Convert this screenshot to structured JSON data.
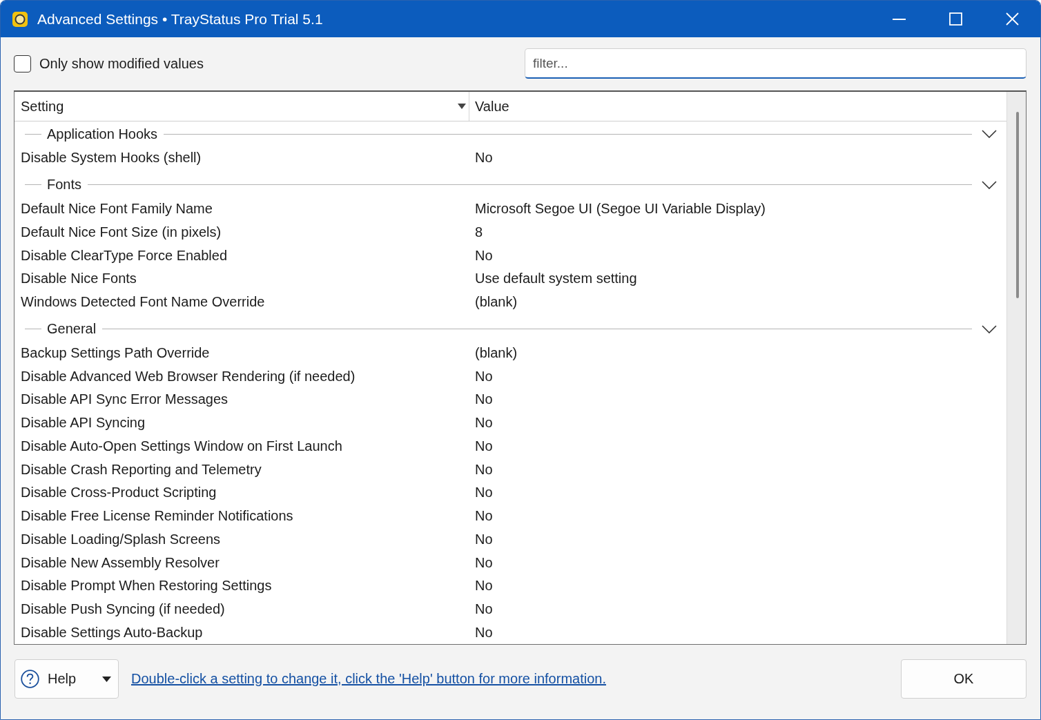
{
  "window": {
    "title": "Advanced Settings • TrayStatus Pro Trial 5.1"
  },
  "toolbar": {
    "only_modified": {
      "label": "Only show modified values",
      "checked": false
    },
    "filter": {
      "placeholder": "filter...",
      "focused": true
    }
  },
  "table": {
    "columns": [
      "Setting",
      "Value"
    ],
    "groups": [
      {
        "name": "Application Hooks",
        "expanded": true,
        "rows": [
          {
            "setting": "Disable System Hooks (shell)",
            "value": "No"
          }
        ]
      },
      {
        "name": "Fonts",
        "expanded": true,
        "rows": [
          {
            "setting": "Default Nice Font Family Name",
            "value": "Microsoft Segoe UI (Segoe UI Variable Display)"
          },
          {
            "setting": "Default Nice Font Size (in pixels)",
            "value": "8"
          },
          {
            "setting": "Disable ClearType Force Enabled",
            "value": "No"
          },
          {
            "setting": "Disable Nice Fonts",
            "value": "Use default system setting"
          },
          {
            "setting": "Windows Detected Font Name Override",
            "value": "(blank)"
          }
        ]
      },
      {
        "name": "General",
        "expanded": true,
        "rows": [
          {
            "setting": "Backup Settings Path Override",
            "value": "(blank)"
          },
          {
            "setting": "Disable Advanced Web Browser Rendering (if needed)",
            "value": "No"
          },
          {
            "setting": "Disable API Sync Error Messages",
            "value": "No"
          },
          {
            "setting": "Disable API Syncing",
            "value": "No"
          },
          {
            "setting": "Disable Auto-Open Settings Window on First Launch",
            "value": "No"
          },
          {
            "setting": "Disable Crash Reporting and Telemetry",
            "value": "No"
          },
          {
            "setting": "Disable Cross-Product Scripting",
            "value": "No"
          },
          {
            "setting": "Disable Free License Reminder Notifications",
            "value": "No"
          },
          {
            "setting": "Disable Loading/Splash Screens",
            "value": "No"
          },
          {
            "setting": "Disable New Assembly Resolver",
            "value": "No"
          },
          {
            "setting": "Disable Prompt When Restoring Settings",
            "value": "No"
          },
          {
            "setting": "Disable Push Syncing (if needed)",
            "value": "No"
          },
          {
            "setting": "Disable Settings Auto-Backup",
            "value": "No"
          }
        ]
      }
    ]
  },
  "footer": {
    "help_button": "Help",
    "hint": "Double-click a setting to change it, click the 'Help' button for more information.",
    "ok_button": "OK"
  }
}
